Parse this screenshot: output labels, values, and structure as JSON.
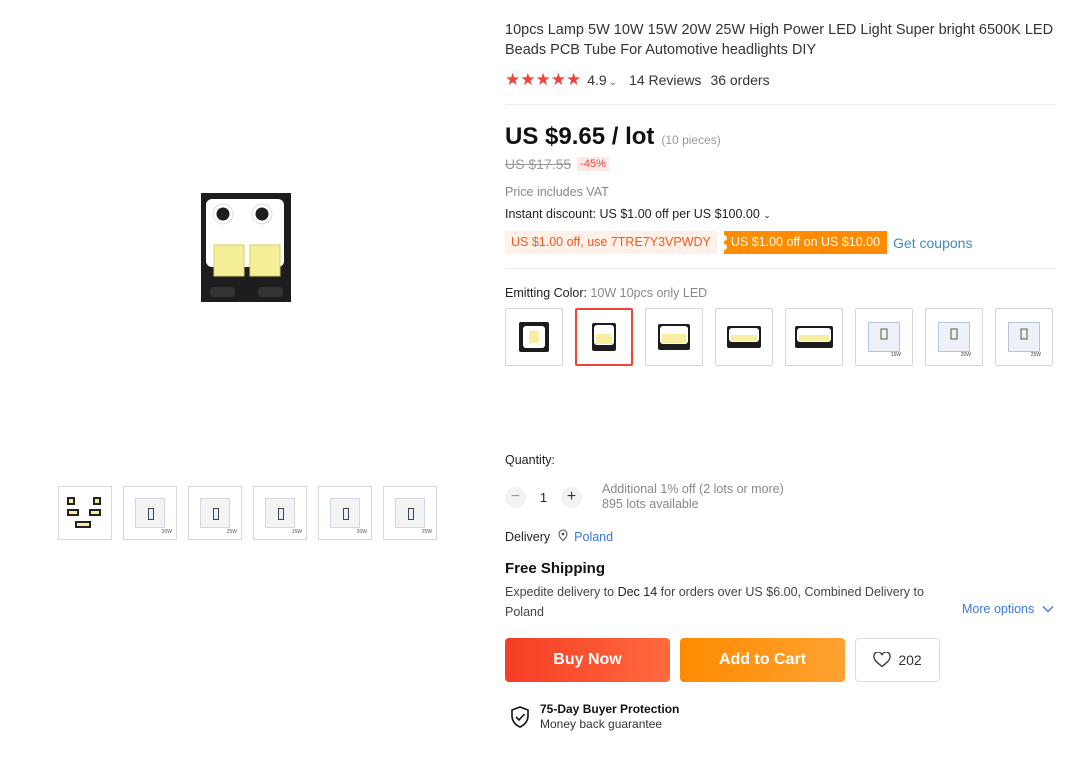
{
  "product": {
    "title": "10pcs Lamp 5W 10W 15W 20W 25W High Power LED Light Super bright 6500K LED Beads PCB Tube For Automotive headlights DIY",
    "rating": "4.9",
    "reviews": "14 Reviews",
    "orders": "36 orders"
  },
  "price": {
    "current": "US $9.65 / lot",
    "pieces": "(10 pieces)",
    "original": "US $17.55",
    "discount": "-45%",
    "vat": "Price includes VAT",
    "instant_discount": "Instant discount: US $1.00 off per US $100.00"
  },
  "coupons": {
    "code": "US $1.00 off, use 7TRE7Y3VPWDY",
    "offer": "US $1.00 off on US $10.00",
    "get": "Get coupons"
  },
  "variants": {
    "label": "Emitting Color:",
    "selected": "10W 10pcs only LED",
    "options": [
      {
        "id": "5w"
      },
      {
        "id": "10w",
        "selected": true
      },
      {
        "id": "15w-black"
      },
      {
        "id": "20w-black"
      },
      {
        "id": "25w-black"
      },
      {
        "id": "15w-pcb",
        "tag": "15W"
      },
      {
        "id": "20w-pcb",
        "tag": "20W"
      },
      {
        "id": "25w-pcb",
        "tag": "25W"
      }
    ]
  },
  "gallery": {
    "thumb_tags": [
      "",
      "20W",
      "25W",
      "15W",
      "20W",
      "25W"
    ]
  },
  "quantity": {
    "label": "Quantity:",
    "value": "1",
    "minus": "−",
    "plus": "+",
    "additional": "Additional 1% off (2 lots or more)",
    "available": "895 lots available"
  },
  "delivery": {
    "label": "Delivery",
    "country": "Poland",
    "shipping": "Free Shipping",
    "expedite_prefix": "Expedite delivery to ",
    "expedite_date": "Dec 14",
    "expedite_suffix": " for orders over US $6.00, Combined Delivery to Poland",
    "more": "More options"
  },
  "actions": {
    "buy": "Buy Now",
    "cart": "Add to Cart",
    "wishlist_count": "202"
  },
  "protection": {
    "title": "75-Day Buyer Protection",
    "subtitle": "Money back guarantee"
  },
  "colors": {
    "accent": "#f0443a",
    "link": "#3c78d8",
    "cart": "#ff8a00"
  }
}
